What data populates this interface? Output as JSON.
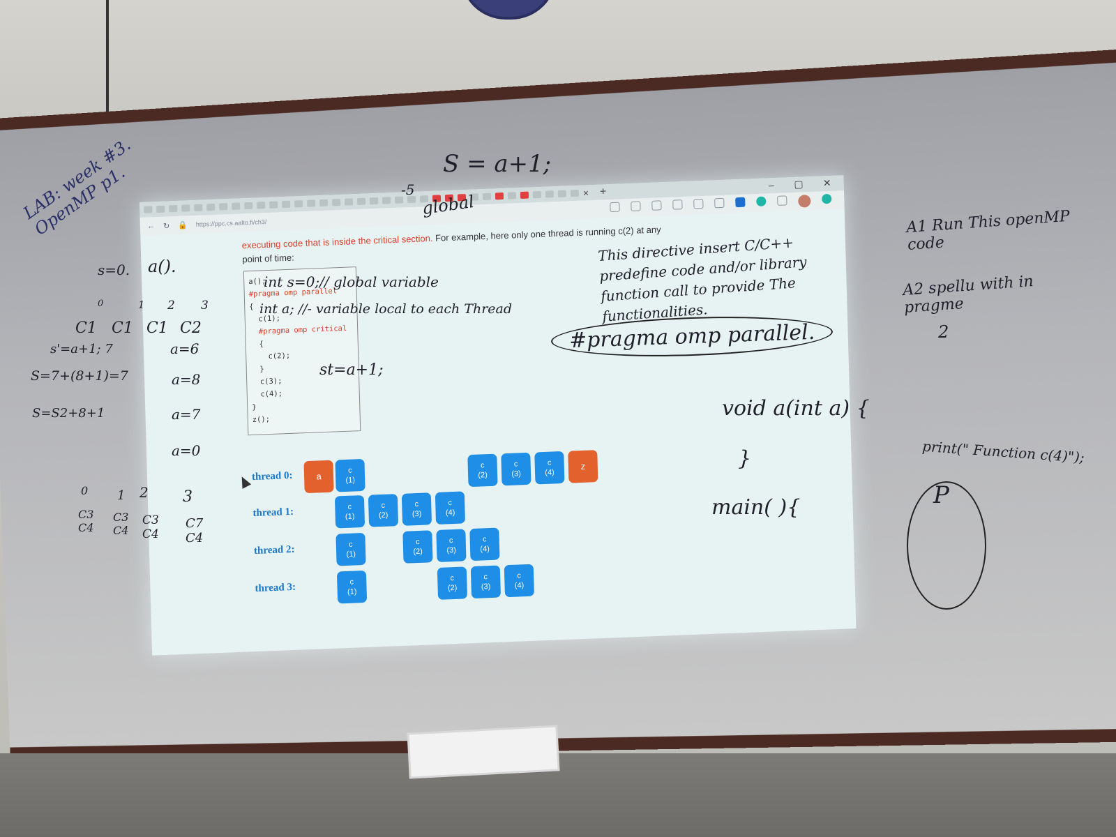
{
  "whiteboard_notes": {
    "left_top": "LAB: week #3.\nOpenMP p1.",
    "top_center_formula": "S = a+1;",
    "top_center_word": "global",
    "top_center_minus": "-5",
    "left_s0": "s=0.",
    "left_ac": "a().",
    "left_lines": [
      "s'=a+1; 7",
      "S=7+(8+1)=7",
      "S=S2+8+1"
    ],
    "left_table_top": [
      "0",
      "1",
      "2",
      "3"
    ],
    "left_table_row": [
      "C1",
      "C1",
      "C1",
      "C2"
    ],
    "left_assignments": [
      "a=6",
      "a=8",
      "a=7",
      "a=0"
    ],
    "left_table_bottom_head": [
      "0",
      "1",
      "2",
      "3"
    ],
    "left_table_bottom_rows": [
      "C3 C4",
      "C3 C4",
      "C3 C4",
      "C7 C4"
    ],
    "right_A1": "A1  Run This openMP code",
    "right_A2": "A2  spellu with in pragme",
    "right_two": "2",
    "right_void": "void a(int a) {",
    "right_brace": "}",
    "right_main": "main( ){",
    "right_print": "print(\" Function c(4)\");",
    "right_p": "P",
    "directive_note": "This directive insert C/C++ predefine code and/or library function call to provide The functionalities.",
    "pragma_note": "#pragma omp parallel.",
    "int_note": "int s=0;// global variable",
    "int_a_note": "int a; //- variable local to each Thread",
    "st_note": "st=a+1;"
  },
  "screen": {
    "url": "https://ppc.cs.aalto.fi/ch3/",
    "intro_highlight": "executing code that is inside the critical section.",
    "intro_rest": " For example, here only one thread is running  c(2)  at any point of time:",
    "code_lines": [
      "a();",
      "#pragma omp parallel",
      "{",
      "  c(1);",
      "  #pragma omp critical",
      "  {",
      "    c(2);",
      "  }",
      "  c(3);",
      "  c(4);",
      "}",
      "z();"
    ],
    "threads": [
      {
        "label": "thread 0:",
        "blocks": [
          {
            "top": "",
            "bottom": "a",
            "kind": "o"
          },
          {
            "top": "c",
            "bottom": "(1)",
            "kind": "c"
          },
          {
            "top": "c",
            "bottom": "(2)",
            "kind": "c"
          },
          {
            "top": "c",
            "bottom": "(3)",
            "kind": "c"
          },
          {
            "top": "c",
            "bottom": "(4)",
            "kind": "c"
          },
          {
            "top": "",
            "bottom": "z",
            "kind": "o"
          }
        ]
      },
      {
        "label": "thread 1:",
        "blocks": [
          {
            "top": "c",
            "bottom": "(1)",
            "kind": "c"
          },
          {
            "top": "c",
            "bottom": "(2)",
            "kind": "c"
          },
          {
            "top": "c",
            "bottom": "(3)",
            "kind": "c"
          },
          {
            "top": "c",
            "bottom": "(4)",
            "kind": "c"
          }
        ]
      },
      {
        "label": "thread 2:",
        "blocks": [
          {
            "top": "c",
            "bottom": "(1)",
            "kind": "c"
          },
          {
            "top": "c",
            "bottom": "(2)",
            "kind": "c"
          },
          {
            "top": "c",
            "bottom": "(3)",
            "kind": "c"
          },
          {
            "top": "c",
            "bottom": "(4)",
            "kind": "c"
          }
        ]
      },
      {
        "label": "thread 3:",
        "blocks": [
          {
            "top": "c",
            "bottom": "(1)",
            "kind": "c"
          },
          {
            "top": "c",
            "bottom": "(2)",
            "kind": "c"
          },
          {
            "top": "c",
            "bottom": "(3)",
            "kind": "c"
          },
          {
            "top": "c",
            "bottom": "(4)",
            "kind": "c"
          }
        ]
      }
    ]
  },
  "colors": {
    "critical_red": "#d8402a",
    "block_blue": "#1e8ee6",
    "block_orange": "#e2612d",
    "thread_label": "#1c78c8"
  }
}
